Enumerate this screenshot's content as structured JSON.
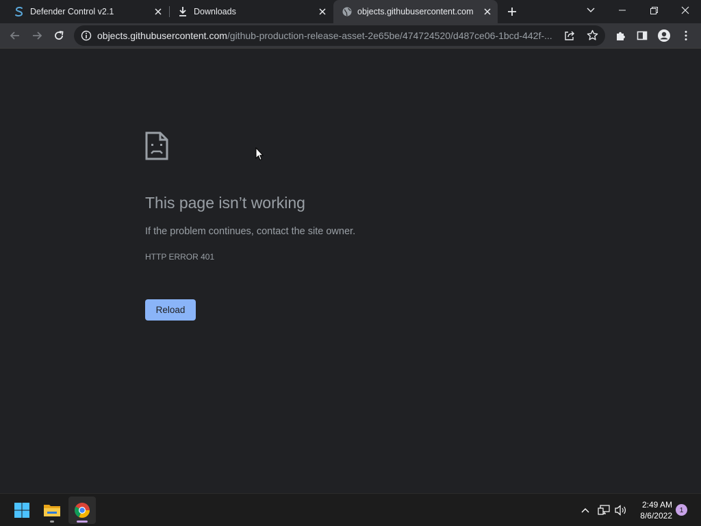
{
  "tabs": [
    {
      "title": "Defender Control v2.1",
      "icon": "s-logo-icon",
      "active": false
    },
    {
      "title": "Downloads",
      "icon": "download-icon",
      "active": false
    },
    {
      "title": "objects.githubusercontent.com",
      "icon": "globe-icon",
      "active": true
    }
  ],
  "address_bar": {
    "host": "objects.githubusercontent.com",
    "path": "/github-production-release-asset-2e65be/474724520/d487ce06-1bcd-442f-..."
  },
  "error_page": {
    "title": "This page isn’t working",
    "message": "If the problem continues, contact the site owner.",
    "code": "HTTP ERROR 401",
    "reload_label": "Reload"
  },
  "taskbar": {
    "apps": [
      "windows-start-icon",
      "file-explorer-icon",
      "chrome-icon"
    ],
    "time": "2:49 AM",
    "date": "8/6/2022",
    "notification_count": "1"
  },
  "colors": {
    "background": "#202124",
    "toolbar": "#35363a",
    "accent": "#8ab4f8",
    "text_secondary": "#9aa0a6"
  }
}
